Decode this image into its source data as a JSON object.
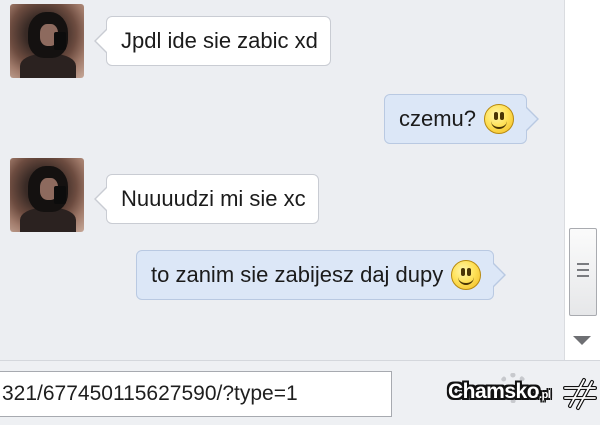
{
  "chat": {
    "messages": [
      {
        "direction": "incoming",
        "text": "Jpdl ide sie zabic xd",
        "emoticon": null
      },
      {
        "direction": "outgoing",
        "text": "czemu?",
        "emoticon": "smiley-icon"
      },
      {
        "direction": "incoming",
        "text": "Nuuuudzi mi sie xc",
        "emoticon": null
      },
      {
        "direction": "outgoing",
        "text": "to zanim sie zabijesz daj dupy",
        "emoticon": "smiley-icon"
      }
    ]
  },
  "bottom_bar": {
    "url_text": "321/677450115627590/?type=1"
  },
  "watermark": {
    "brand": "Chamsko",
    "suffix": ".pl"
  },
  "colors": {
    "incoming_bubble": "#ffffff",
    "outgoing_bubble": "#dce7f7",
    "background": "#eceef2"
  }
}
